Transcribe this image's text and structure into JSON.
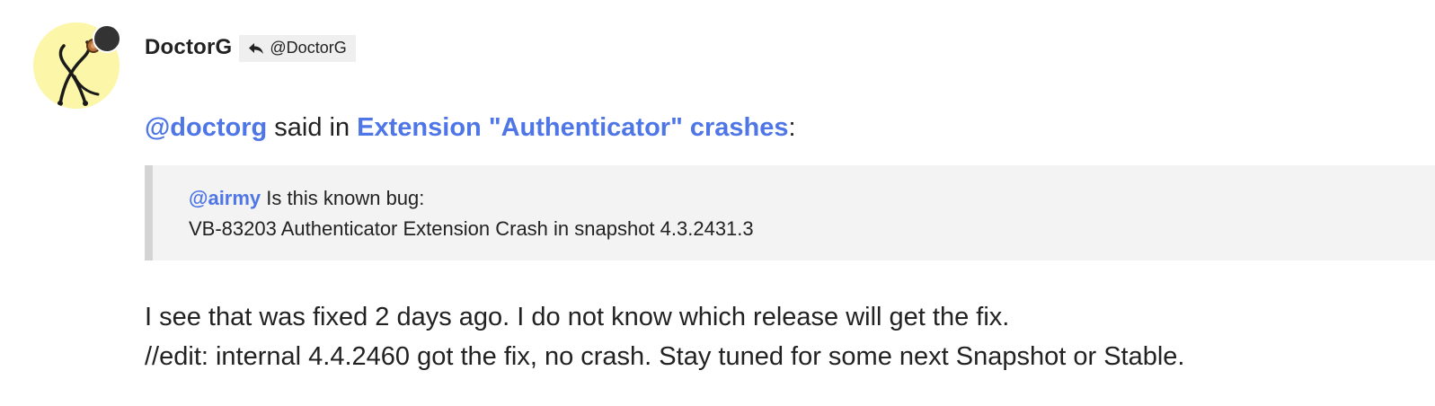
{
  "post": {
    "author": {
      "display_name": "DoctorG",
      "avatar_icon": "stethoscope-icon",
      "avatar_bg": "#fbf6a8",
      "status_color": "#333333"
    },
    "reply_badge": {
      "icon": "reply-arrow-icon",
      "label": "@DoctorG"
    },
    "mention": {
      "user_link": "@doctorg",
      "said_in": " said in ",
      "topic_link": "Extension \"Authenticator\" crashes",
      "trailing": ":"
    },
    "quote": {
      "mention": "@airmy",
      "line1_text": " Is this known bug:",
      "line2_text": "VB-83203 Authenticator Extension Crash in snapshot 4.3.2431.3"
    },
    "body": {
      "line1": "I see that was fixed 2 days ago. I do not know which release will get the fix.",
      "line2": "//edit: internal 4.4.2460 got the fix, no crash. Stay tuned for some next Snapshot or Stable."
    },
    "colors": {
      "link": "#4f76e6",
      "quote_bg": "#f3f3f3",
      "quote_border": "#d4d4d4",
      "badge_bg": "#efefef"
    }
  }
}
